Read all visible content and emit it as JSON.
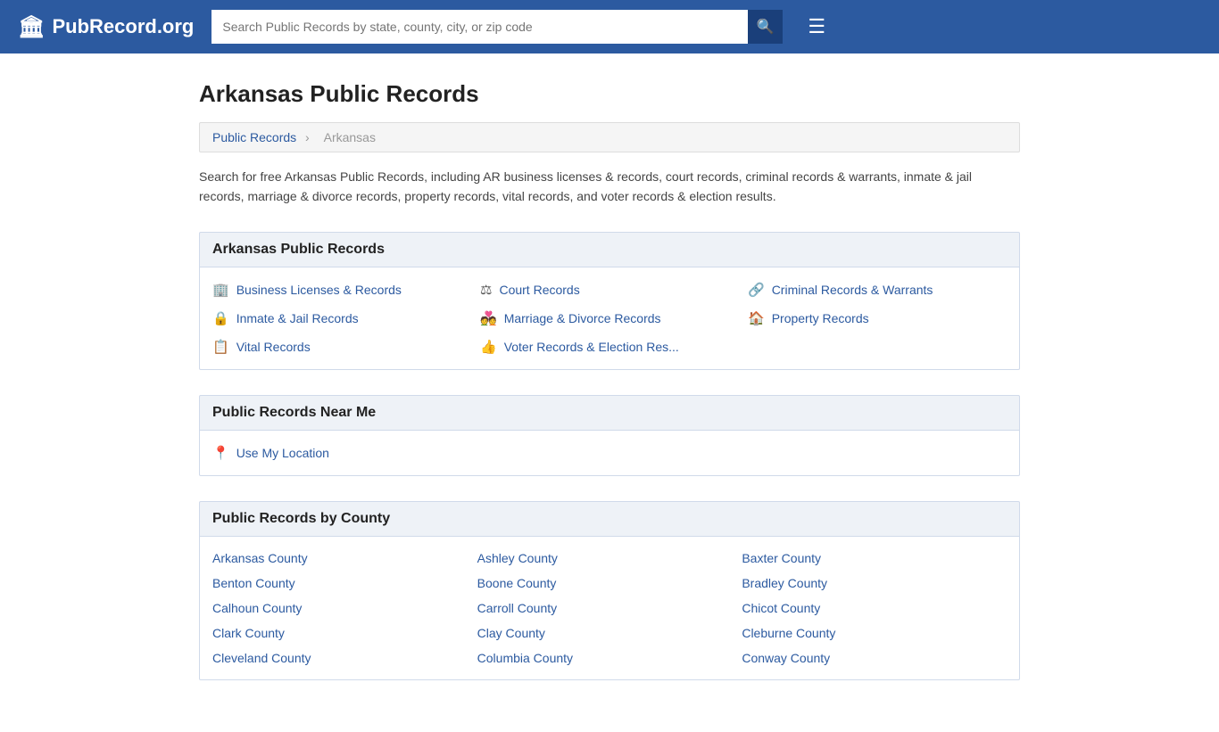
{
  "header": {
    "logo_text": "PubRecord.org",
    "search_placeholder": "Search Public Records by state, county, city, or zip code",
    "menu_icon": "☰"
  },
  "page": {
    "title": "Arkansas Public Records",
    "breadcrumb": {
      "parent_label": "Public Records",
      "parent_url": "#",
      "current": "Arkansas"
    },
    "description": "Search for free Arkansas Public Records, including AR business licenses & records, court records, criminal records & warrants, inmate & jail records, marriage & divorce records, property records, vital records, and voter records & election results."
  },
  "records_section": {
    "heading": "Arkansas Public Records",
    "items": [
      {
        "icon": "🏢",
        "label": "Business Licenses & Records",
        "url": "#"
      },
      {
        "icon": "⚖",
        "label": "Court Records",
        "url": "#"
      },
      {
        "icon": "🔗",
        "label": "Criminal Records & Warrants",
        "url": "#"
      },
      {
        "icon": "🔒",
        "label": "Inmate & Jail Records",
        "url": "#"
      },
      {
        "icon": "💑",
        "label": "Marriage & Divorce Records",
        "url": "#"
      },
      {
        "icon": "🏠",
        "label": "Property Records",
        "url": "#"
      },
      {
        "icon": "📋",
        "label": "Vital Records",
        "url": "#"
      },
      {
        "icon": "👍",
        "label": "Voter Records & Election Res...",
        "url": "#"
      }
    ]
  },
  "near_me_section": {
    "heading": "Public Records Near Me",
    "item_label": "Use My Location",
    "item_icon": "📍"
  },
  "county_section": {
    "heading": "Public Records by County",
    "counties": [
      "Arkansas County",
      "Ashley County",
      "Baxter County",
      "Benton County",
      "Boone County",
      "Bradley County",
      "Calhoun County",
      "Carroll County",
      "Chicot County",
      "Clark County",
      "Clay County",
      "Cleburne County",
      "Cleveland County",
      "Columbia County",
      "Conway County"
    ]
  }
}
